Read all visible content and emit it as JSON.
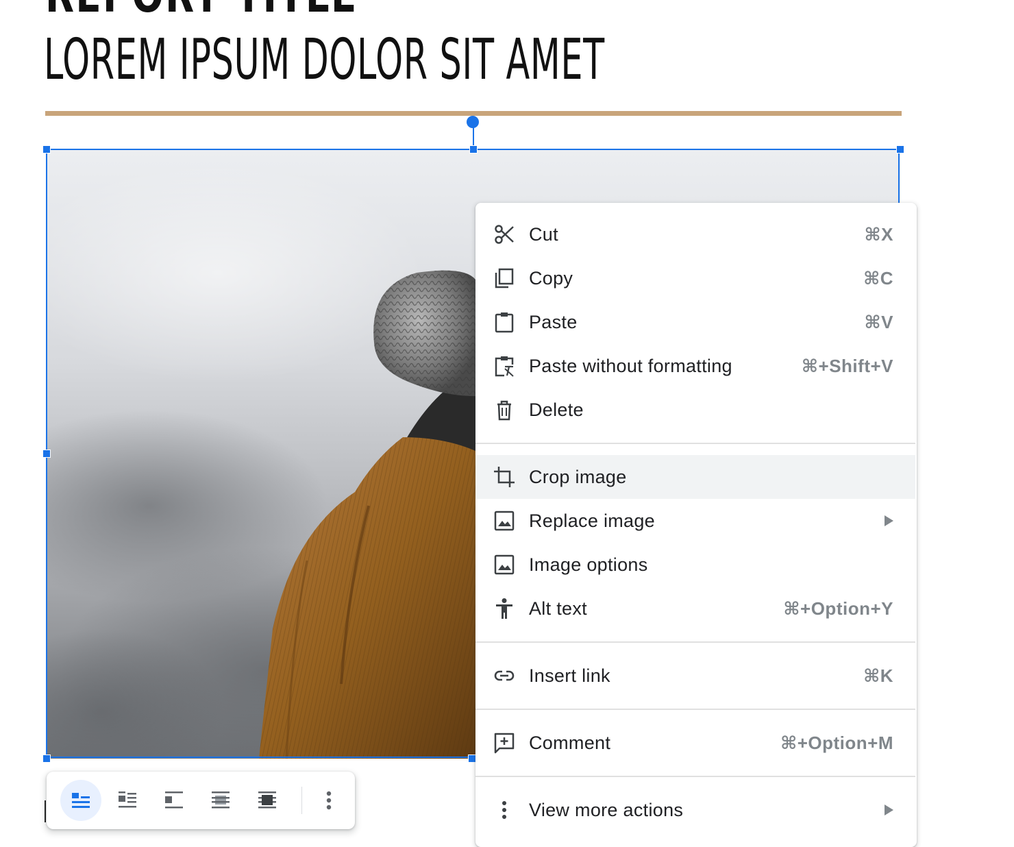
{
  "document": {
    "title_partial": "REPORT TITLE",
    "subtitle": "LOREM IPSUM DOLOR SIT AMET",
    "rule_color": "#c8a47a"
  },
  "selection": {
    "color": "#1a73e8"
  },
  "image_toolbar": {
    "buttons": [
      {
        "icon": "inline-icon",
        "active": true
      },
      {
        "icon": "wrap-text-icon",
        "active": false
      },
      {
        "icon": "break-text-icon",
        "active": false
      },
      {
        "icon": "behind-text-icon",
        "active": false
      },
      {
        "icon": "in-front-of-text-icon",
        "active": false
      },
      {
        "icon": "more-options-icon",
        "active": false
      }
    ]
  },
  "context_menu": {
    "items": [
      {
        "label": "Cut",
        "shortcut": "⌘X",
        "icon": "scissors-icon"
      },
      {
        "label": "Copy",
        "shortcut": "⌘C",
        "icon": "copy-icon"
      },
      {
        "label": "Paste",
        "shortcut": "⌘V",
        "icon": "clipboard-icon"
      },
      {
        "label": "Paste without formatting",
        "shortcut": "⌘+Shift+V",
        "icon": "clipboard-clear-format-icon"
      },
      {
        "label": "Delete",
        "shortcut": "",
        "icon": "trash-icon"
      },
      {
        "label": "Crop image",
        "shortcut": "",
        "icon": "crop-icon",
        "highlighted": true
      },
      {
        "label": "Replace image",
        "shortcut": "",
        "icon": "image-icon",
        "submenu": true
      },
      {
        "label": "Image options",
        "shortcut": "",
        "icon": "image-icon"
      },
      {
        "label": "Alt text",
        "shortcut": "⌘+Option+Y",
        "icon": "accessibility-icon"
      },
      {
        "label": "Insert link",
        "shortcut": "⌘K",
        "icon": "link-icon"
      },
      {
        "label": "Comment",
        "shortcut": "⌘+Option+M",
        "icon": "add-comment-icon"
      },
      {
        "label": "View more actions",
        "shortcut": "",
        "icon": "more-vert-icon",
        "submenu": true
      }
    ]
  }
}
